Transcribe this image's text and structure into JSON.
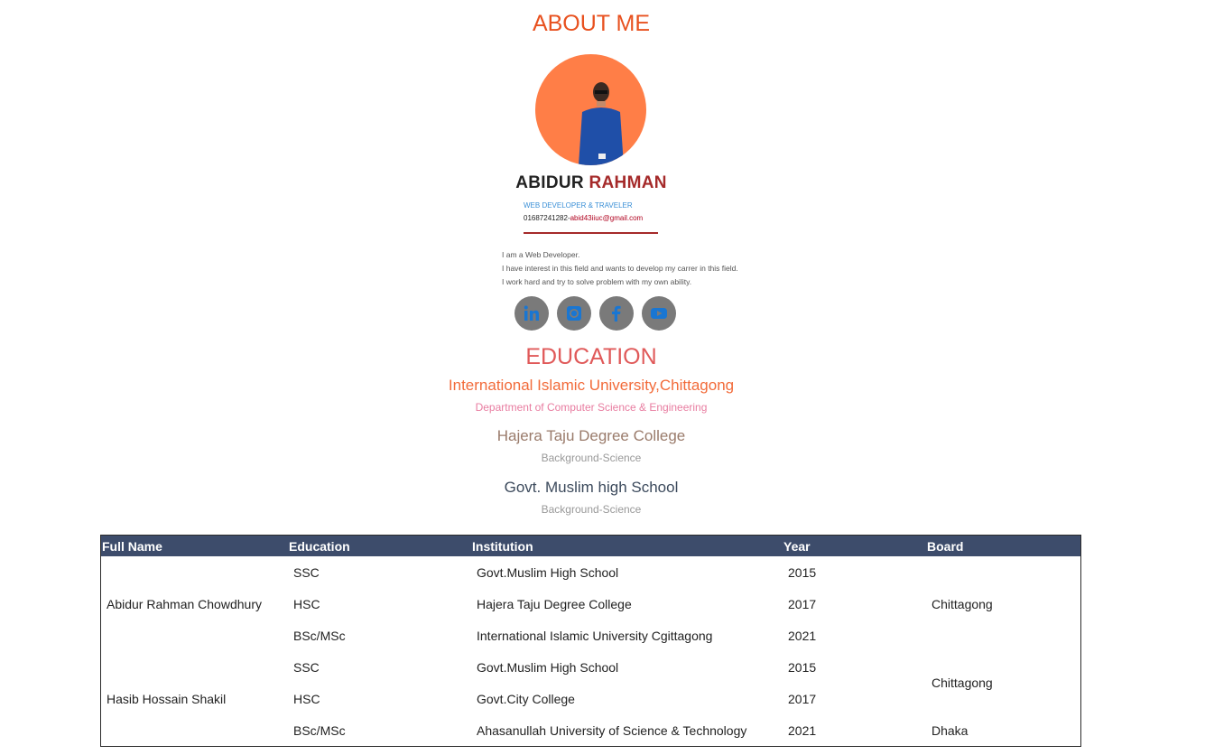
{
  "about": {
    "title": "ABOUT ME"
  },
  "profile": {
    "first_name": "ABIDUR",
    "last_name": "RAHMAN",
    "role": "WEB DEVELOPER & TRAVELER",
    "phone": "01687241282-",
    "email": "abid43iiuc@gmail.com",
    "bio": [
      "I am a Web Developer.",
      "I have interest in this field and wants to develop my carrer in this field.",
      "I work hard and try to solve problem with my own ability."
    ]
  },
  "social": [
    "linkedin-icon",
    "github-icon",
    "facebook-icon",
    "youtube-icon"
  ],
  "education": {
    "title": "EDUCATION",
    "items": [
      {
        "name": "International Islamic University,Chittagong",
        "sub": "Department of Computer Science & Engineering"
      },
      {
        "name": "Hajera Taju Degree College",
        "sub": "Background-Science"
      },
      {
        "name": "Govt. Muslim high School",
        "sub": "Background-Science"
      }
    ]
  },
  "table": {
    "headers": [
      "Full Name",
      "Education",
      "Institution",
      "Year",
      "Board"
    ],
    "groups": [
      {
        "name": "Abidur Rahman Chowdhury",
        "rows": [
          {
            "education": "SSC",
            "institution": "Govt.Muslim High School",
            "year": "2015"
          },
          {
            "education": "HSC",
            "institution": "Hajera Taju Degree College",
            "year": "2017"
          },
          {
            "education": "BSc/MSc",
            "institution": "International Islamic University Cgittagong",
            "year": "2021"
          }
        ],
        "board": "Chittagong"
      },
      {
        "name": "Hasib Hossain Shakil",
        "rows": [
          {
            "education": "SSC",
            "institution": "Govt.Muslim High School",
            "year": "2015"
          },
          {
            "education": "HSC",
            "institution": "Govt.City College",
            "year": "2017"
          },
          {
            "education": "BSc/MSc",
            "institution": "Ahasanullah University of Science & Technology",
            "year": "2021"
          }
        ],
        "board": "Chittagong",
        "board2": "Dhaka"
      }
    ]
  }
}
